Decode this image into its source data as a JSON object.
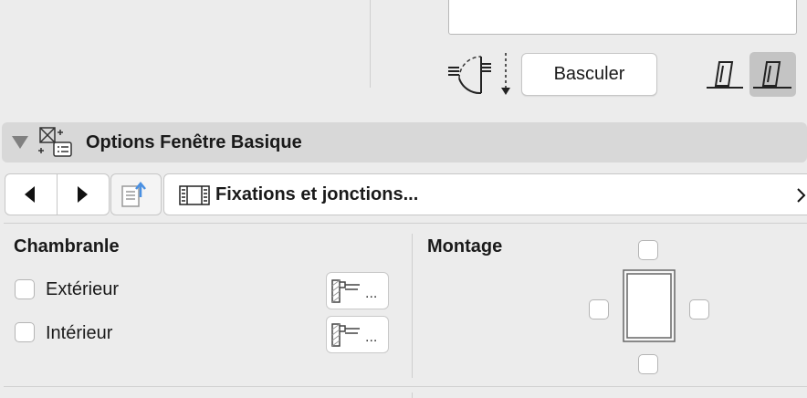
{
  "toolbar": {
    "flip_label": "Basculer"
  },
  "panel": {
    "title": "Options Fenêtre Basique"
  },
  "nav": {
    "section_label": "Fixations et jonctions..."
  },
  "chambranle": {
    "title": "Chambranle",
    "items": [
      {
        "label": "Extérieur",
        "checked": false,
        "button_label": "..."
      },
      {
        "label": "Intérieur",
        "checked": false,
        "button_label": "..."
      }
    ]
  },
  "montage": {
    "title": "Montage",
    "top_checked": false,
    "left_checked": false,
    "right_checked": false,
    "bottom_checked": false
  },
  "icons": {
    "swing": "door-swing-icon",
    "collapse": "triangle-down-icon",
    "panel": "window-options-icon",
    "prev": "chevron-left-icon",
    "next": "chevron-right-icon",
    "favorite": "favorites-icon",
    "section": "film-strip-icon",
    "more": "chevron-right-icon"
  }
}
